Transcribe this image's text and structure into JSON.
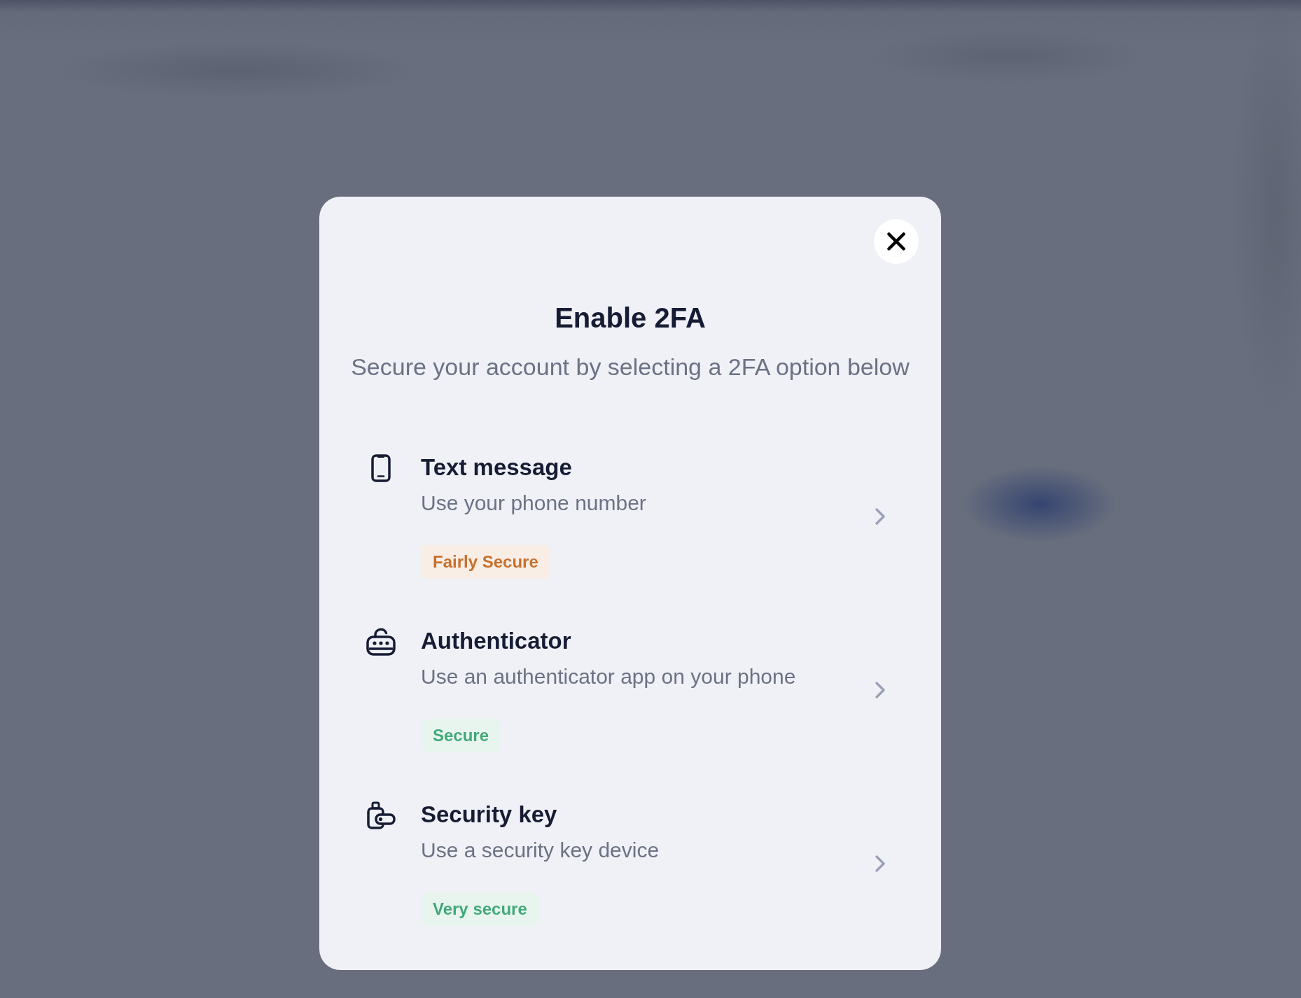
{
  "dialog": {
    "title": "Enable 2FA",
    "subtitle": "Secure your account by selecting a 2FA option below"
  },
  "options": [
    {
      "kind": "sms",
      "title": "Text message",
      "description": "Use your phone number",
      "badge": {
        "label": "Fairly Secure",
        "color": "#c8702c"
      }
    },
    {
      "kind": "authenticator",
      "title": "Authenticator",
      "description": "Use an authenticator app on your phone",
      "badge": {
        "label": "Secure",
        "color": "#43a979"
      }
    },
    {
      "kind": "key",
      "title": "Security key",
      "description": "Use a security key device",
      "badge": {
        "label": "Very secure",
        "color": "#43a979"
      }
    }
  ]
}
